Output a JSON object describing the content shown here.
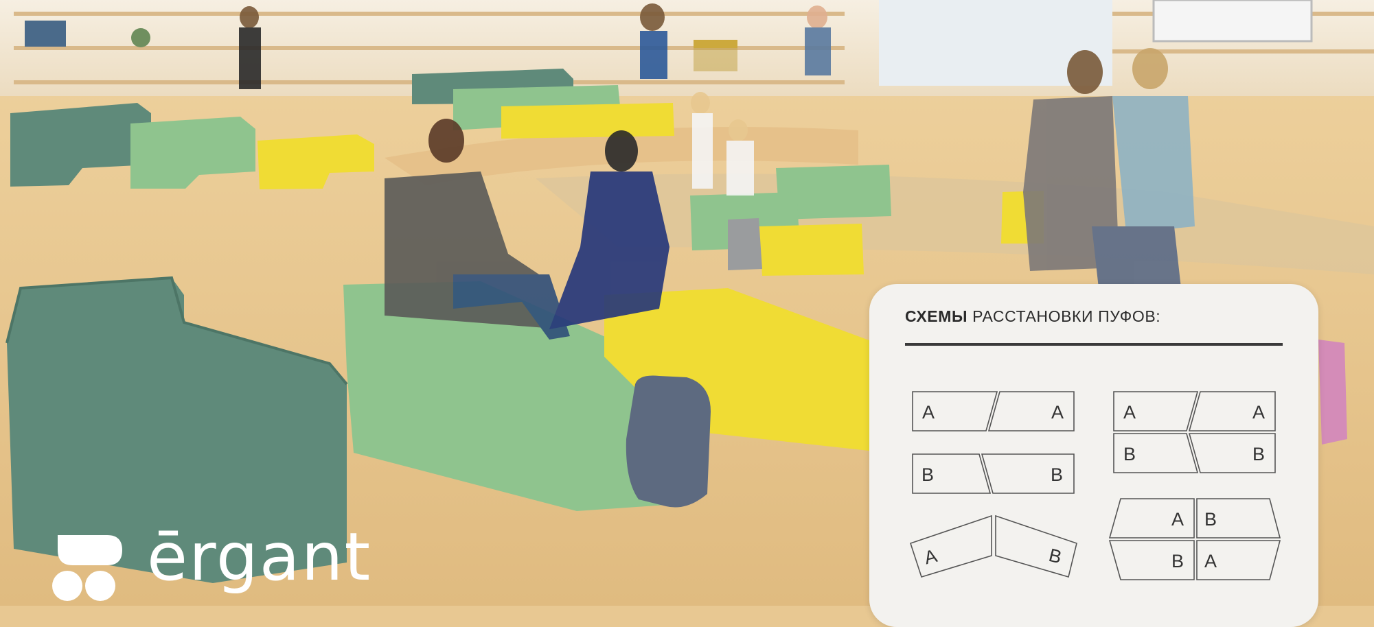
{
  "panel": {
    "title_bold": "СХЕМЫ",
    "title_rest": " РАССТАНОВКИ ПУФОВ:"
  },
  "schemes": {
    "s1": [
      "A",
      "A"
    ],
    "s2": [
      "B",
      "B"
    ],
    "s3": [
      "A",
      "B"
    ],
    "s4": [
      "A",
      "A",
      "B",
      "B"
    ],
    "s5": [
      "A",
      "B",
      "B",
      "A"
    ]
  },
  "brand": {
    "name": "ērgant"
  },
  "colors": {
    "pouf_dark_green": "#5f8a7a",
    "pouf_light_green": "#8fc48e",
    "pouf_yellow": "#f0dc34",
    "floor": "#e8c892",
    "panel_bg": "#f3f2ef"
  }
}
